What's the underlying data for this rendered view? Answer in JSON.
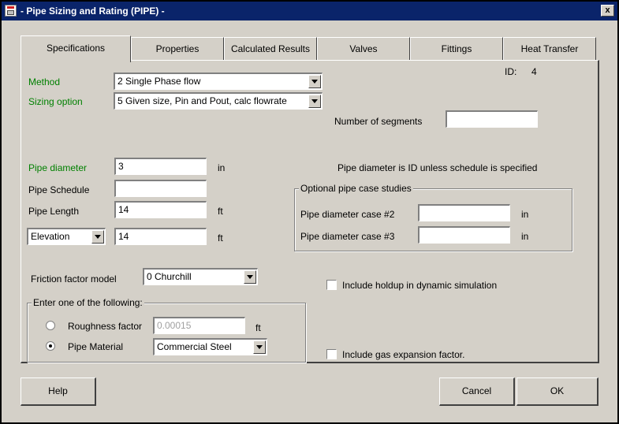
{
  "window": {
    "title": "- Pipe Sizing and Rating (PIPE) -",
    "close_label": "x"
  },
  "tabs": [
    "Specifications",
    "Properties",
    "Calculated Results",
    "Valves",
    "Fittings",
    "Heat Transfer"
  ],
  "id": {
    "label": "ID:",
    "value": "4"
  },
  "method": {
    "label": "Method",
    "value": "2 Single Phase flow"
  },
  "sizing": {
    "label": "Sizing option",
    "value": "5 Given size, Pin and Pout, calc flowrate"
  },
  "segments": {
    "label": "Number of segments",
    "value": ""
  },
  "pipe_diameter": {
    "label": "Pipe diameter",
    "value": "3",
    "unit": "in"
  },
  "pipe_schedule": {
    "label": "Pipe Schedule",
    "value": ""
  },
  "pipe_length": {
    "label": "Pipe Length",
    "value": "14",
    "unit": "ft"
  },
  "elevation": {
    "select": "Elevation",
    "value": "14",
    "unit": "ft"
  },
  "diameter_note": "Pipe diameter is ID unless schedule is specified",
  "case_studies": {
    "title": "Optional pipe case studies",
    "case2": {
      "label": "Pipe diameter case #2",
      "value": "",
      "unit": "in"
    },
    "case3": {
      "label": "Pipe diameter case #3",
      "value": "",
      "unit": "in"
    }
  },
  "friction": {
    "label": "Friction factor model",
    "value": "0 Churchill"
  },
  "holdup": {
    "label": "Include holdup in dynamic simulation",
    "checked": false
  },
  "roughness_group": {
    "title": "Enter one of the following:",
    "roughness": {
      "label": "Roughness factor",
      "value": "0.00015",
      "unit": "ft",
      "selected": false
    },
    "material": {
      "label": "Pipe Material",
      "value": "Commercial Steel",
      "selected": true
    }
  },
  "gas_expansion": {
    "label": "Include gas expansion factor.",
    "checked": false
  },
  "buttons": {
    "help": "Help",
    "cancel": "Cancel",
    "ok": "OK"
  },
  "colors": {
    "title_bar": "#0a246a",
    "face": "#d4d0c8",
    "green_label": "#008000"
  }
}
